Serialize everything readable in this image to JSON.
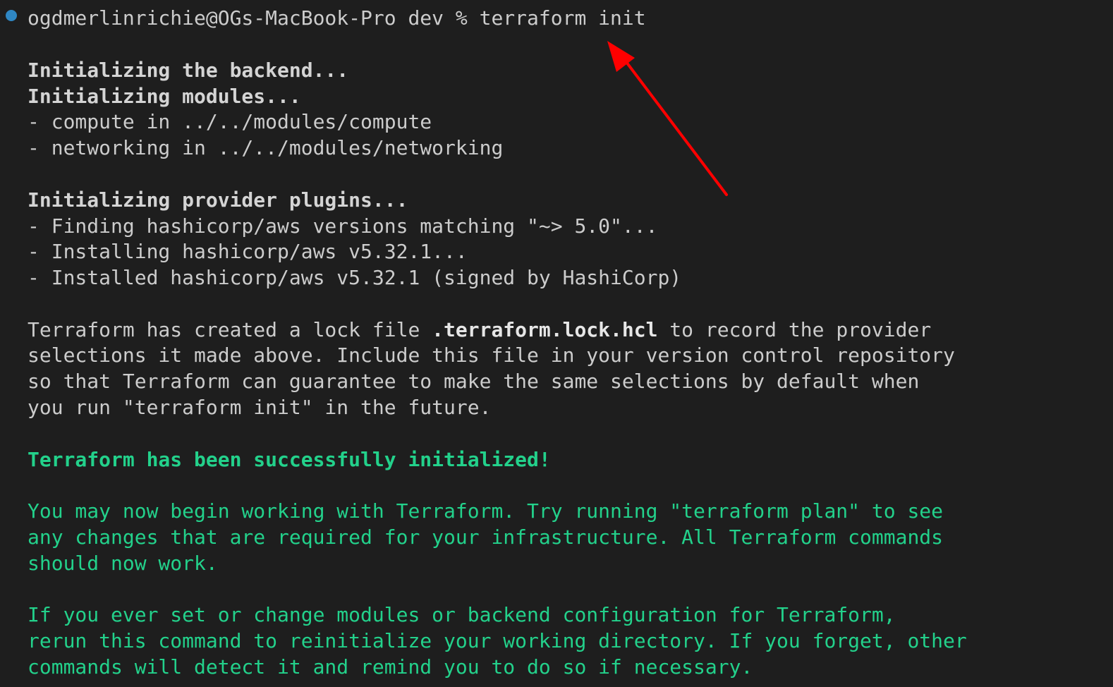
{
  "colors": {
    "background": "#1e1e1e",
    "text": "#cccccc",
    "success_green": "#23d18b",
    "status_dot": "#2f87c4",
    "annotation_arrow": "#ff0000"
  },
  "prompt": {
    "status_icon": "circle-status-icon",
    "text": "ogdmerlinrichie@OGs-MacBook-Pro dev % terraform init"
  },
  "backend": {
    "init_backend": "Initializing the backend...",
    "init_modules": "Initializing modules...",
    "modules": [
      "- compute in ../../modules/compute",
      "- networking in ../../modules/networking"
    ]
  },
  "providers": {
    "heading": "Initializing provider plugins...",
    "lines": [
      "- Finding hashicorp/aws versions matching \"~> 5.0\"...",
      "- Installing hashicorp/aws v5.32.1...",
      "- Installed hashicorp/aws v5.32.1 (signed by HashiCorp)"
    ]
  },
  "lockfile": {
    "line1_prefix": "Terraform has created a lock file ",
    "line1_filename": ".terraform.lock.hcl",
    "line1_suffix": " to record the provider",
    "line2": "selections it made above. Include this file in your version control repository",
    "line3": "so that Terraform can guarantee to make the same selections by default when",
    "line4": "you run \"terraform init\" in the future."
  },
  "success": {
    "headline": "Terraform has been successfully initialized!",
    "para1": [
      "You may now begin working with Terraform. Try running \"terraform plan\" to see",
      "any changes that are required for your infrastructure. All Terraform commands",
      "should now work."
    ],
    "para2": [
      "If you ever set or change modules or backend configuration for Terraform,",
      "rerun this command to reinitialize your working directory. If you forget, other",
      "commands will detect it and remind you to do so if necessary."
    ]
  },
  "annotation": {
    "icon": "red-arrow-annotation-icon"
  }
}
